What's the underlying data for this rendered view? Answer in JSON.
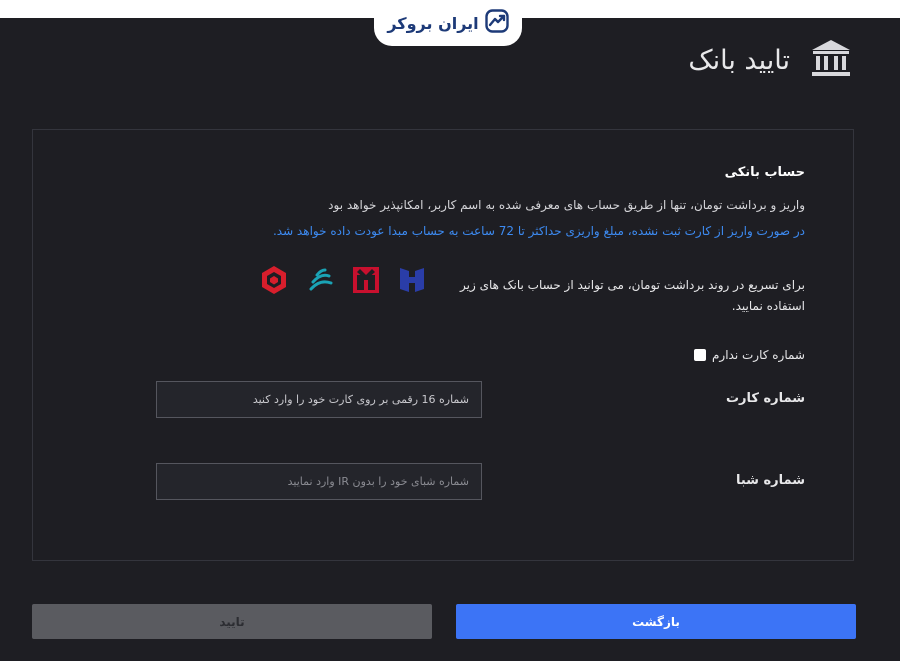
{
  "brand": {
    "name": "ایران بروکر"
  },
  "header": {
    "title": "تایید بانک",
    "icon": "bank-icon"
  },
  "bank_section": {
    "title": "حساب بانکی",
    "description": "واریز و برداشت تومان، تنها از طریق حساب های معرفی شده به اسم کاربر، امکانپذیر خواهد بود",
    "note": "در صورت واریز از کارت ثبت نشده، مبلغ واریزی حداکثر تا 72 ساعت به حساب مبدا عودت داده خواهد شد.",
    "fast_withdraw_text": "برای تسریع در روند برداشت تومان، می توانید از حساب بانک های زیر استفاده نمایید.",
    "bank_logos": [
      "saderat-bank-logo",
      "refah-bank-logo",
      "mellat-bank-logo",
      "pasargad-bank-logo"
    ],
    "bank_colors": {
      "saderat": "#2a3da8",
      "mellat": "#c8102e",
      "refah": "#1aa3b5",
      "pasargad": "#d81e2c"
    }
  },
  "no_card": {
    "label": "شماره کارت ندارم",
    "checked": false
  },
  "card_number": {
    "label": "شماره کارت",
    "placeholder": "شماره 16 رقمی بر روی کارت خود را وارد کنید"
  },
  "sheba_number": {
    "label": "شماره شبا",
    "placeholder": "شماره شبای خود را بدون IR وارد نمایید"
  },
  "buttons": {
    "back": "بازگشت",
    "confirm": "تایید"
  },
  "colors": {
    "background": "#1e1e23",
    "accent": "#3c74f6",
    "note": "#3d8bf2",
    "disabled": "#5a5b60"
  }
}
